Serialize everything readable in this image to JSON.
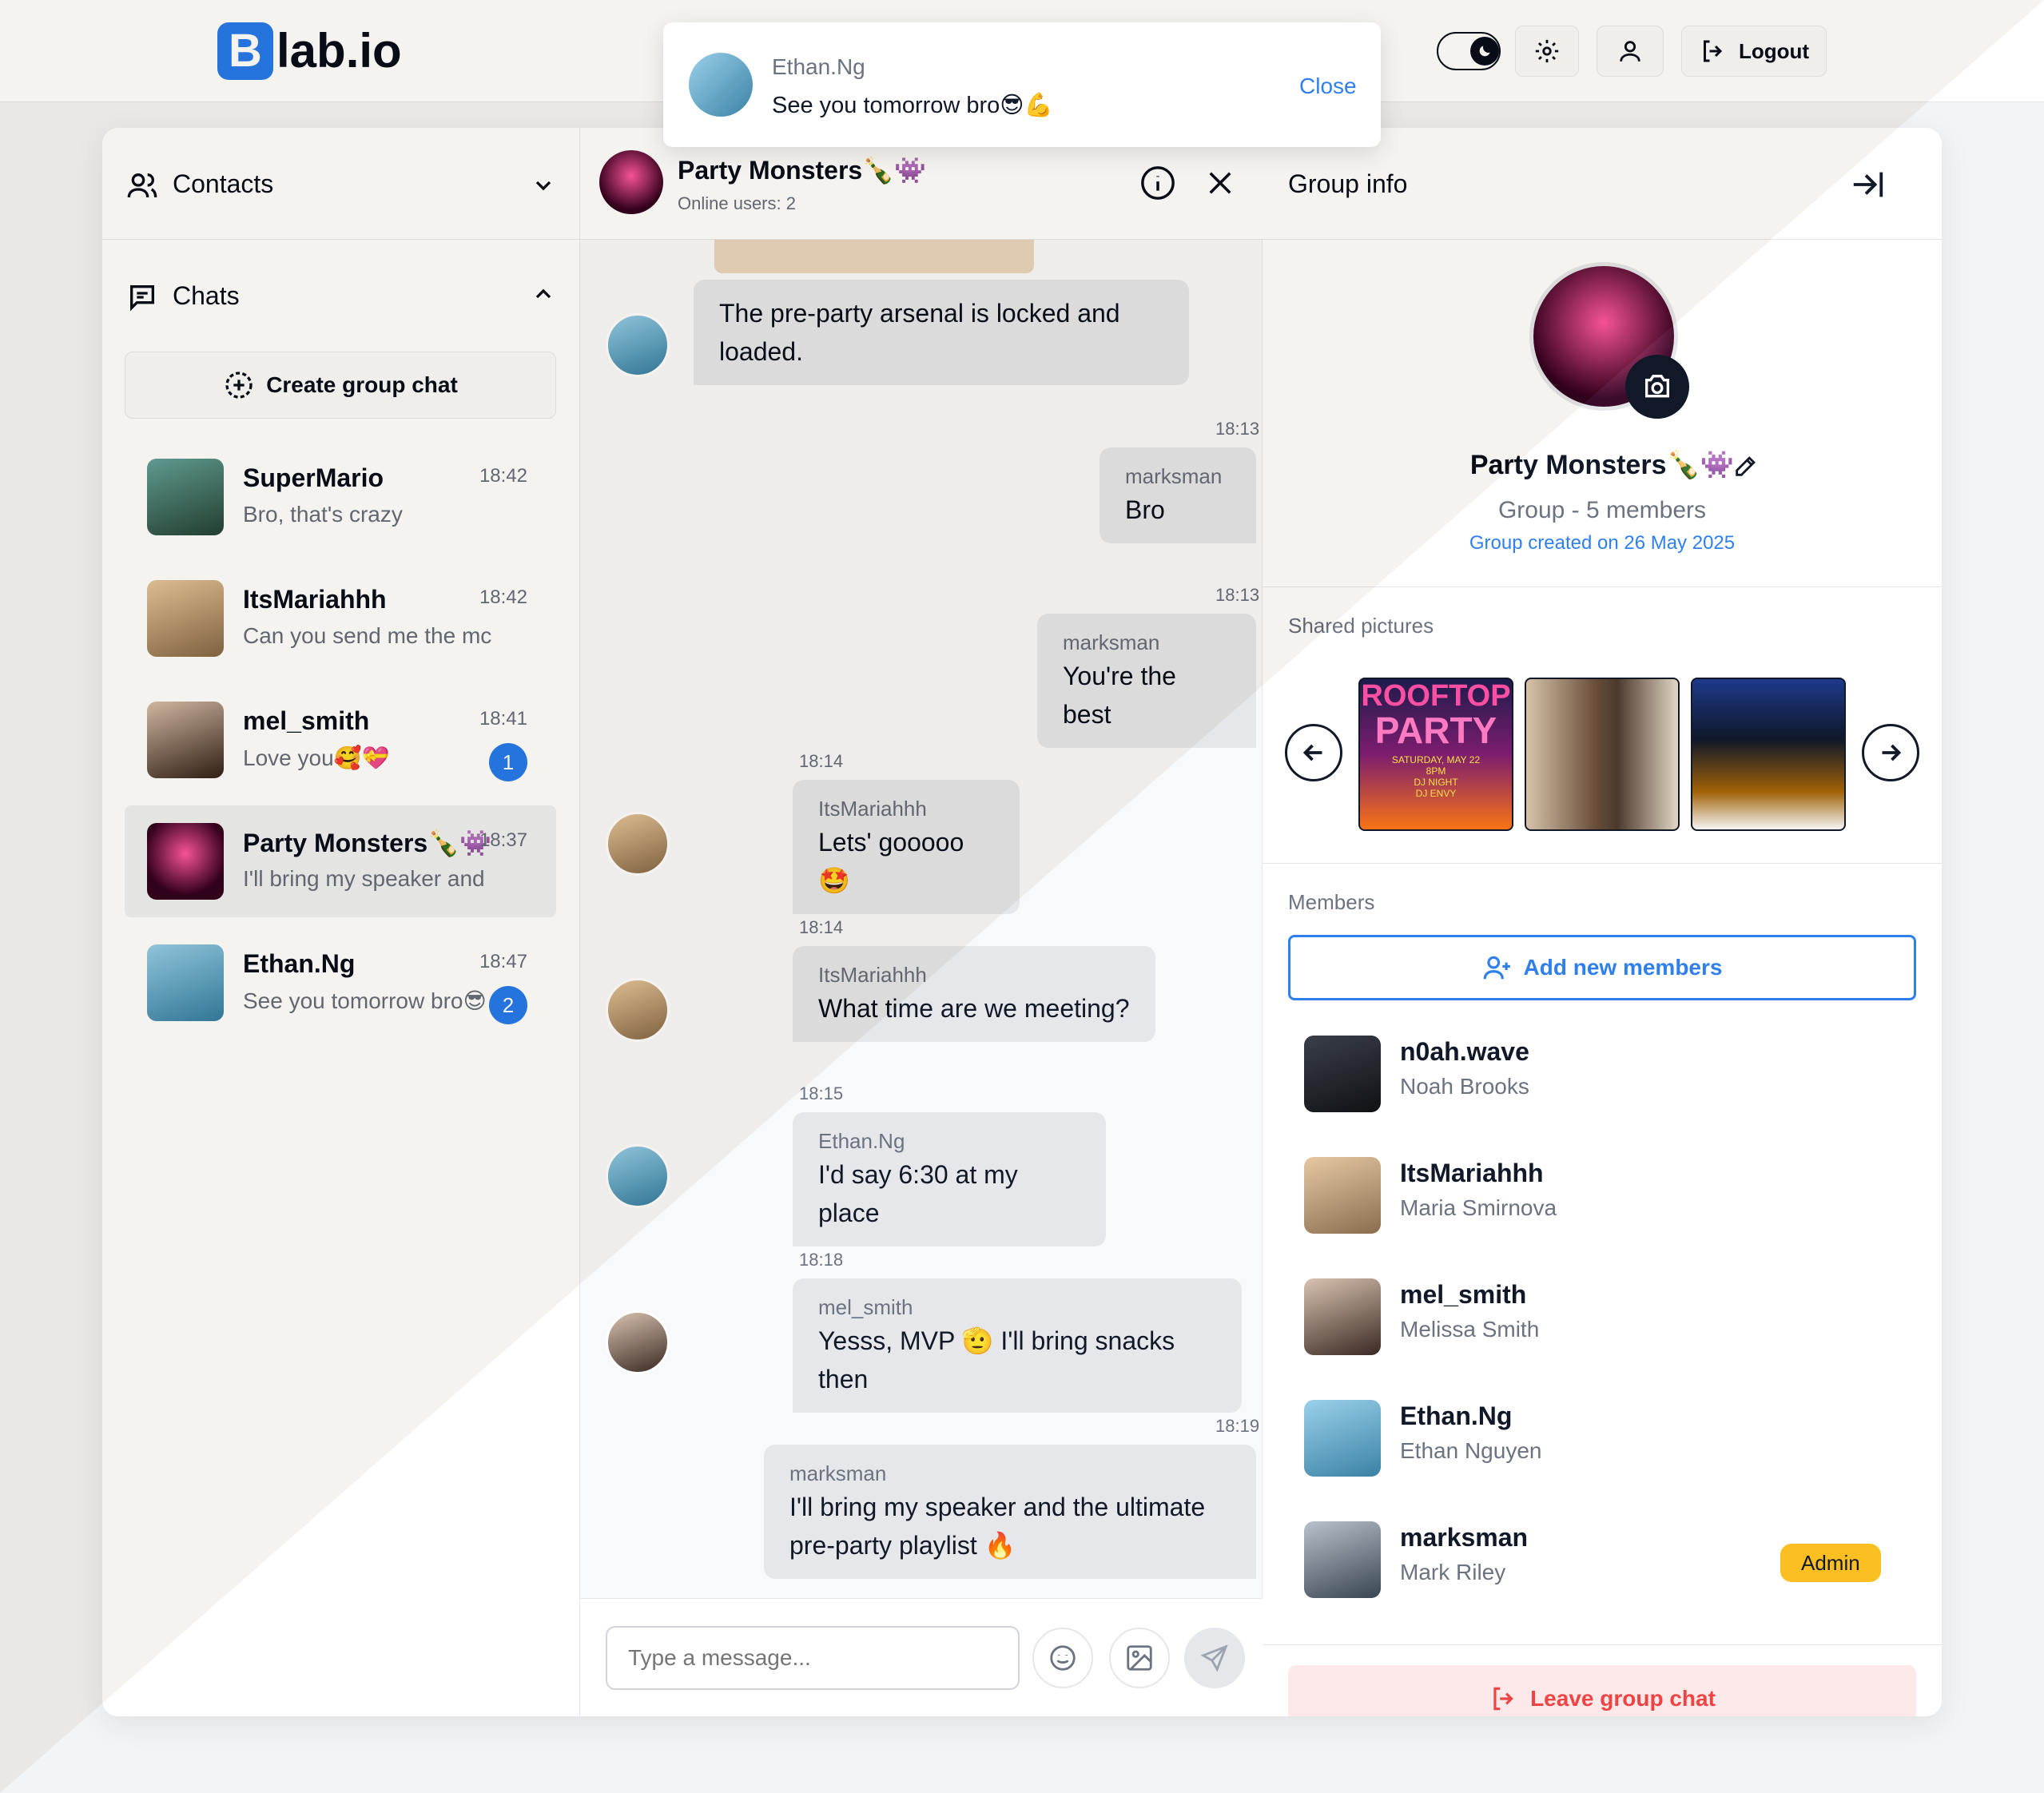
{
  "brand": {
    "letter": "B",
    "name": "lab.io"
  },
  "topbar": {
    "logout_label": "Logout"
  },
  "notification": {
    "sender": "Ethan.Ng",
    "message": "See you tomorrow bro😎💪",
    "close_label": "Close"
  },
  "sidebar": {
    "contacts_label": "Contacts",
    "chats_label": "Chats",
    "create_group_label": "Create group chat",
    "chats": [
      {
        "name": "SuperMario",
        "time": "18:42",
        "preview": "Bro, that's crazy",
        "badge": ""
      },
      {
        "name": "ItsMariahhh",
        "time": "18:42",
        "preview": "Can you send me the mc",
        "badge": ""
      },
      {
        "name": "mel_smith",
        "time": "18:41",
        "preview": "Love you🥰💝",
        "badge": "1"
      },
      {
        "name": "Party Monsters🍾👾",
        "time": "18:37",
        "preview": "I'll bring my speaker and",
        "badge": ""
      },
      {
        "name": "Ethan.Ng",
        "time": "18:47",
        "preview": "See you tomorrow bro😎",
        "badge": "2"
      }
    ]
  },
  "chat": {
    "title": "Party Monsters🍾👾",
    "subtitle": "Online users: 2",
    "messages": [
      {
        "time": "",
        "sender": "",
        "text": "The pre-party arsenal is locked and loaded."
      },
      {
        "time": "18:13",
        "sender": "marksman",
        "text": "Bro"
      },
      {
        "time": "18:13",
        "sender": "marksman",
        "text": "You're the best"
      },
      {
        "time": "18:14",
        "sender": "ItsMariahhh",
        "text": "Lets' gooooo🤩"
      },
      {
        "time": "18:14",
        "sender": "ItsMariahhh",
        "text": "What time are we meeting?"
      },
      {
        "time": "18:15",
        "sender": "Ethan.Ng",
        "text": "I'd say 6:30 at my place"
      },
      {
        "time": "18:18",
        "sender": "mel_smith",
        "text": "Yesss, MVP 🫡 I'll bring snacks then"
      },
      {
        "time": "18:19",
        "sender": "marksman",
        "text": "I'll bring my speaker and the ultimate pre-party playlist 🔥"
      }
    ],
    "input_placeholder": "Type a message..."
  },
  "info": {
    "title": "Group info",
    "group_name": "Party Monsters🍾👾",
    "group_meta": "Group - 5 members",
    "group_created": "Group created on 26 May 2025",
    "shared_label": "Shared pictures",
    "poster": {
      "line1": "ROOFTOP",
      "line2": "PARTY",
      "line3": "SATURDAY, MAY 22",
      "line4": "8PM",
      "line5": "DJ NIGHT",
      "line6": "DJ ENVY"
    },
    "members_label": "Members",
    "add_members_label": "Add new members",
    "members": [
      {
        "handle": "n0ah.wave",
        "name": "Noah Brooks",
        "role": ""
      },
      {
        "handle": "ItsMariahhh",
        "name": "Maria Smirnova",
        "role": ""
      },
      {
        "handle": "mel_smith",
        "name": "Melissa Smith",
        "role": ""
      },
      {
        "handle": "Ethan.Ng",
        "name": "Ethan Nguyen",
        "role": ""
      },
      {
        "handle": "marksman",
        "name": "Mark Riley",
        "role": "Admin"
      }
    ],
    "leave_label": "Leave group chat"
  },
  "colors": {
    "accent": "#2f80ed",
    "dark_bg": "#1b1e25",
    "admin_badge": "#fbbf24",
    "danger": "#ef4444"
  }
}
